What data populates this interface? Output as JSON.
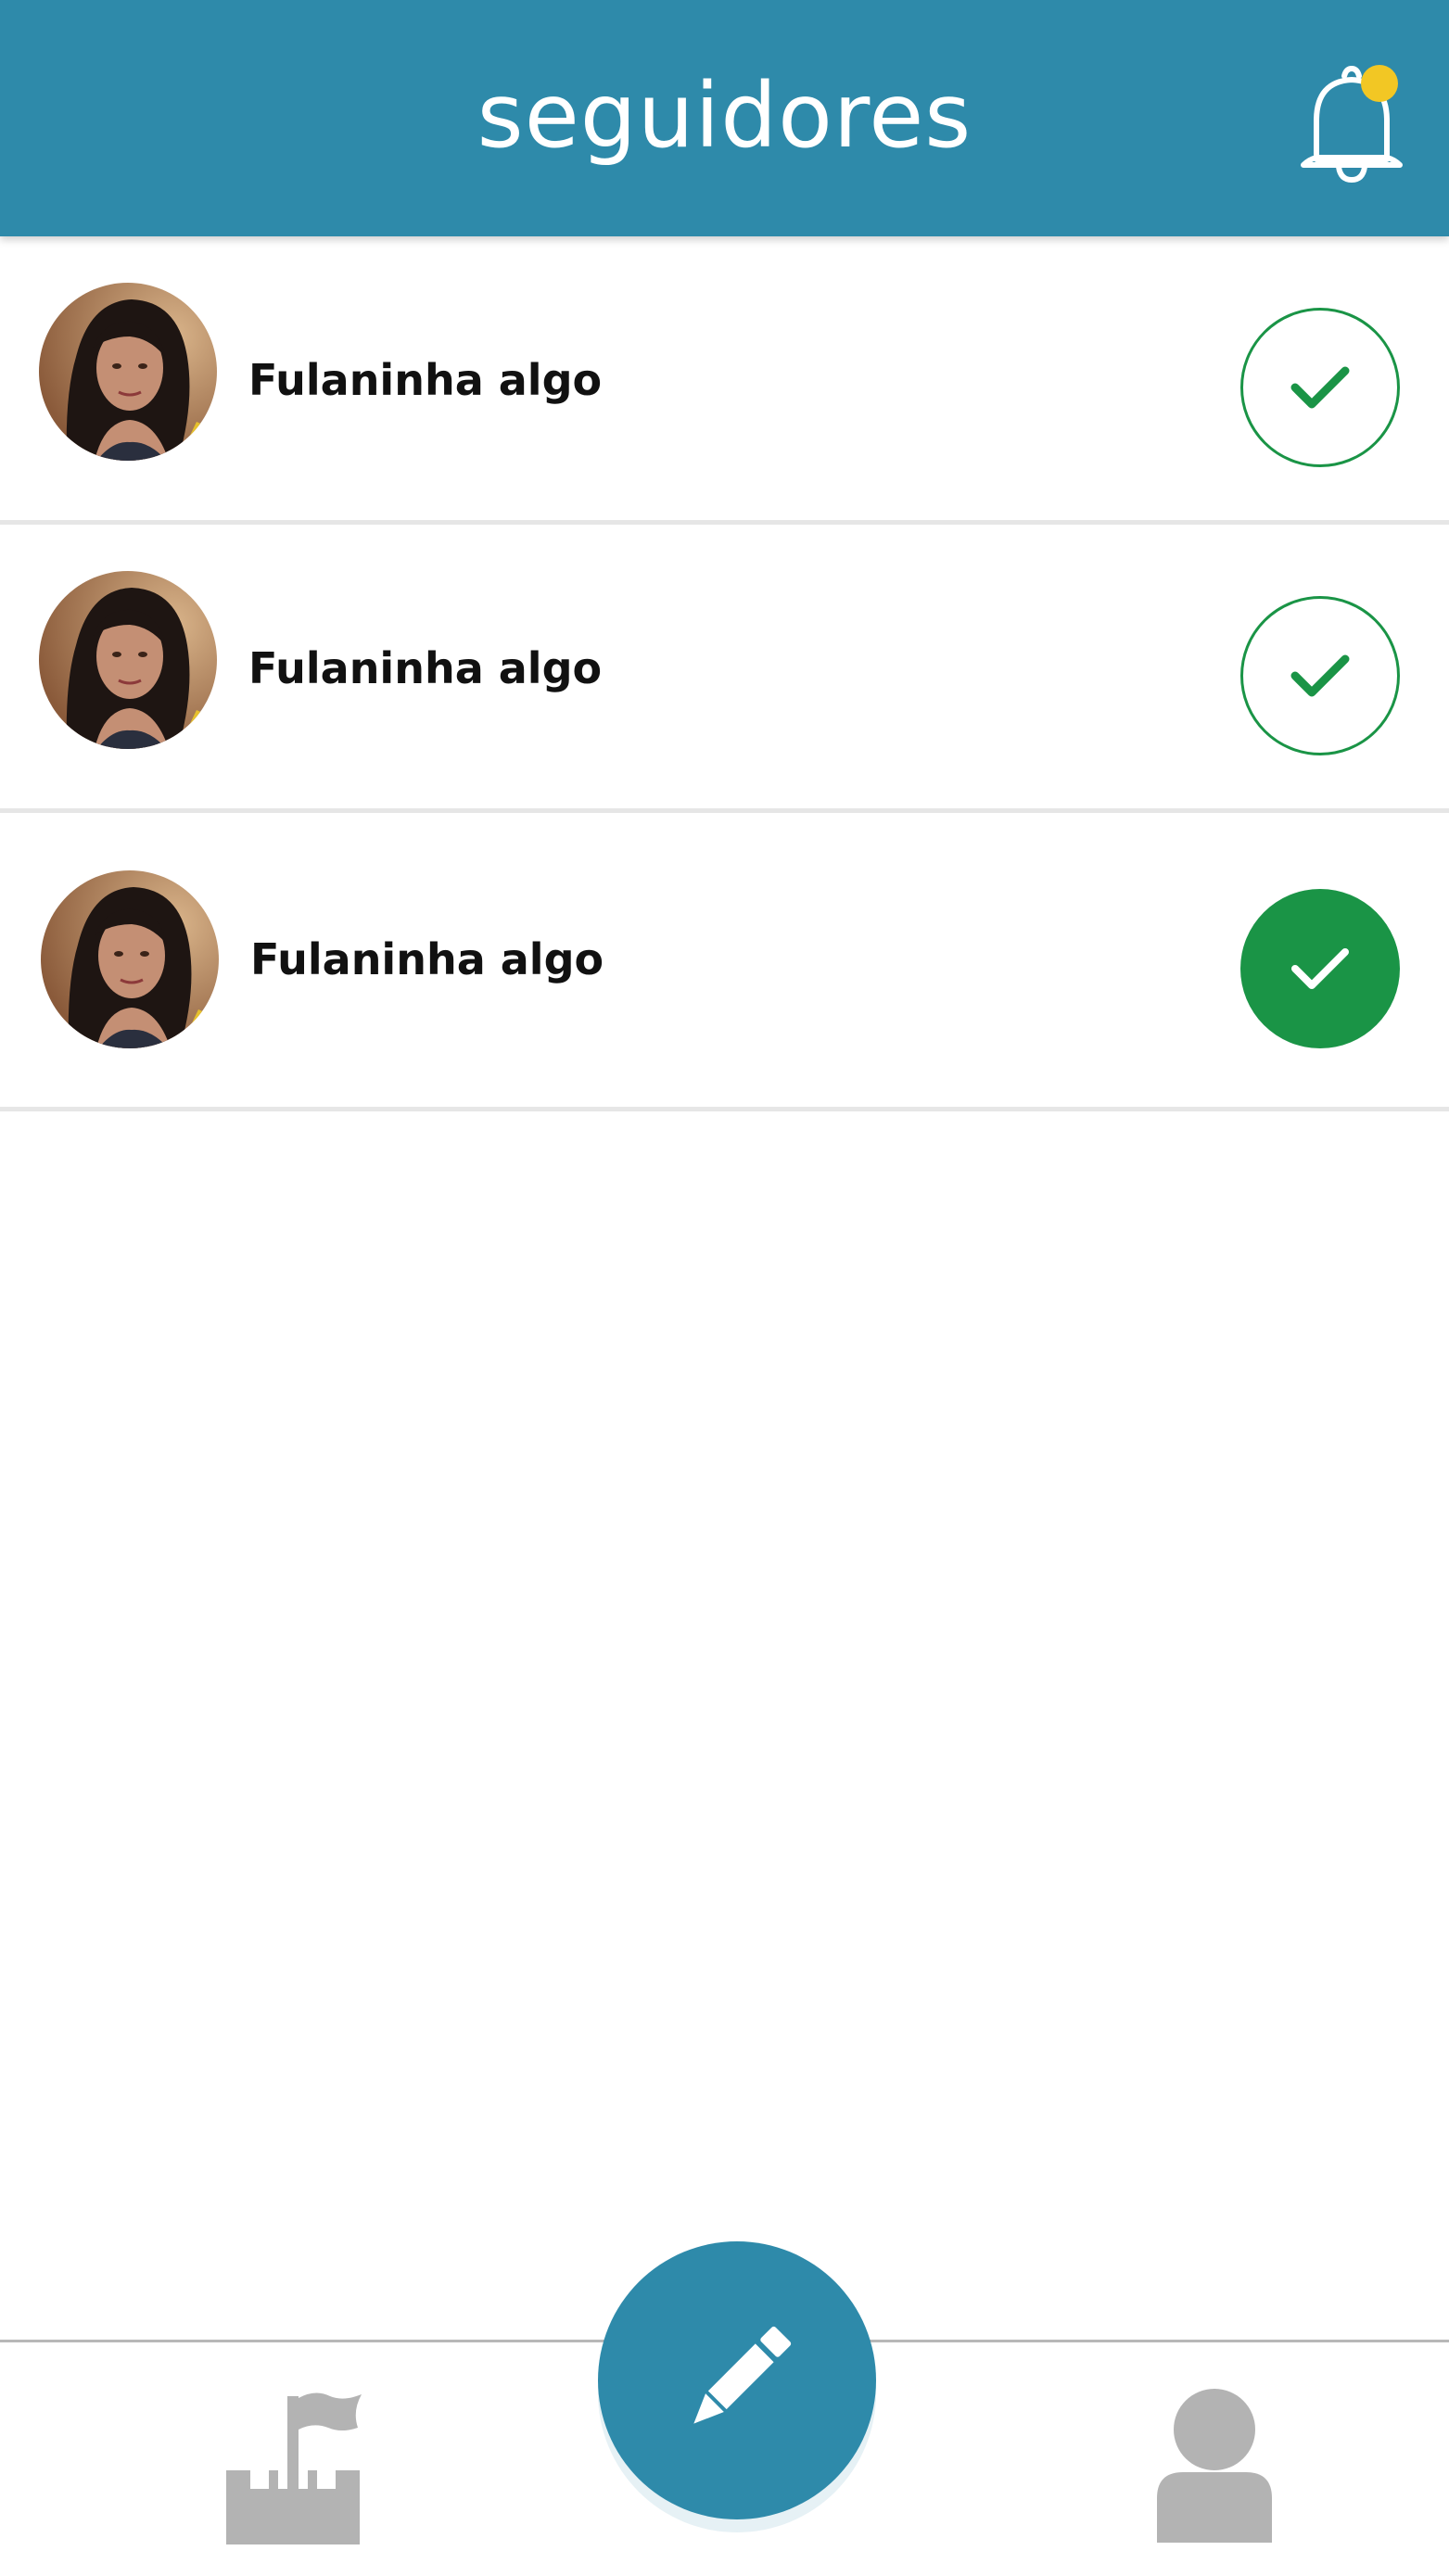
{
  "header": {
    "title": "seguidores",
    "bell_icon": "bell-icon",
    "notification_dot_color": "#f2c724"
  },
  "followers": [
    {
      "name": "Fulaninha algo",
      "status": "outline-check"
    },
    {
      "name": "Fulaninha algo",
      "status": "outline-check"
    },
    {
      "name": "Fulaninha algo",
      "status": "filled-check"
    }
  ],
  "bottom_nav": {
    "home_icon": "castle-flag-icon",
    "fab_icon": "pencil-icon",
    "profile_icon": "user-icon"
  },
  "colors": {
    "primary": "#2e8aaa",
    "success": "#1a9446",
    "inactive_icon": "#b3b3b3"
  }
}
